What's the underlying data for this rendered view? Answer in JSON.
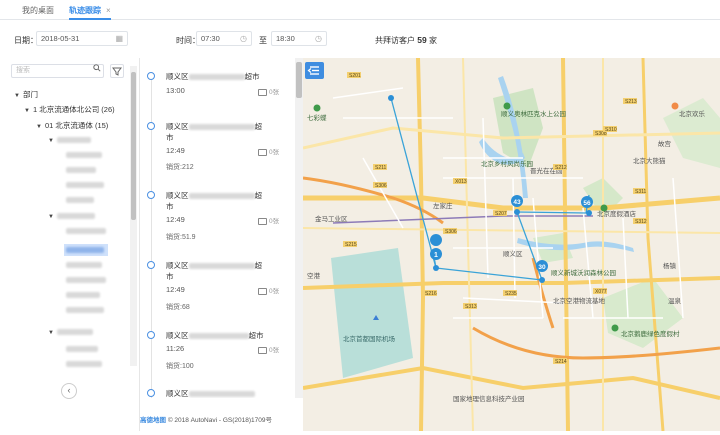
{
  "tabs": [
    {
      "label": "我的桌面"
    },
    {
      "label": "轨迹跟踪",
      "close": "×"
    }
  ],
  "filter": {
    "date_label": "日期：",
    "date_value": "2018-05-31",
    "time_label": "时间：",
    "time_start": "07:30",
    "time_sep": "至",
    "time_end": "18:30",
    "visit_prefix": "共拜访客户",
    "visit_count": "59",
    "visit_suffix": "家"
  },
  "left": {
    "search_placeholder": "搜索",
    "tree": {
      "root": "部门",
      "company": "1 北京流通体北公司 (26)",
      "group": "01 北京流通体 (15)"
    }
  },
  "records": [
    {
      "addr_prefix": "顺义区",
      "addr_suffix": "超市",
      "time": "13:00",
      "photo": "0张",
      "visit": ""
    },
    {
      "addr_prefix": "顺义区",
      "addr_suffix": "超",
      "addr_line2": "市",
      "time": "12:49",
      "photo": "0张",
      "visit": "销货:212"
    },
    {
      "addr_prefix": "顺义区",
      "addr_suffix": "超",
      "addr_line2": "市",
      "time": "12:49",
      "photo": "0张",
      "visit": "销货:51.9"
    },
    {
      "addr_prefix": "顺义区",
      "addr_suffix": "超",
      "addr_line2": "市",
      "time": "12:49",
      "photo": "0张",
      "visit": "销货:68"
    },
    {
      "addr_prefix": "顺义区",
      "addr_suffix": "超市",
      "time": "11:26",
      "photo": "0张",
      "visit": "销货:100"
    },
    {
      "addr_prefix": "顺义区",
      "addr_suffix": "",
      "time": "",
      "photo": "",
      "visit": ""
    }
  ],
  "map": {
    "markers": [
      {
        "label": "1"
      },
      {
        "label": "30"
      },
      {
        "label": "43"
      },
      {
        "label": "56"
      }
    ],
    "places": [
      "北京首都国际机场",
      "顺义新城沃润森林公园",
      "北京乡村风尚乐园",
      "顺义奥林匹克水上公园",
      "国家地理信息科技产业园",
      "北京鹅鹿绿色度假村",
      "北京度假酒店",
      "七彩蝶",
      "北京欢乐",
      "金马工业区",
      "空港",
      "左家庄",
      "北京空港物流基地",
      "北京大熊猫",
      "顺义区",
      "杨镇",
      "温泉",
      "晋光在在圆",
      "故宫"
    ],
    "roads": [
      "S201",
      "S211",
      "S212",
      "S213",
      "S215",
      "S216",
      "S235",
      "S207",
      "S306",
      "S308",
      "S310",
      "S311",
      "S312",
      "S313",
      "S214",
      "X077",
      "X013",
      "S306"
    ],
    "footer_logo": "高德地图",
    "footer_copyright": "© 2018 AutoNavi - GS(2018)1709号",
    "colors": {
      "route": "#3aa3d8",
      "marker": "#2b8fd6",
      "accent": "#3f8de0"
    }
  }
}
